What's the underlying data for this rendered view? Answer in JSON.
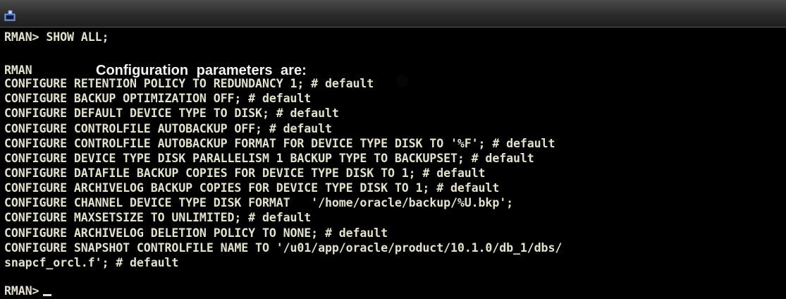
{
  "terminal": {
    "command_prompt": "RMAN> SHOW ALL;",
    "config_prefix": "RMAN",
    "config_heading": "Configuration parameters are:",
    "config_lines": [
      "CONFIGURE RETENTION POLICY TO REDUNDANCY 1; # default",
      "CONFIGURE BACKUP OPTIMIZATION OFF; # default",
      "CONFIGURE DEFAULT DEVICE TYPE TO DISK; # default",
      "CONFIGURE CONTROLFILE AUTOBACKUP OFF; # default",
      "CONFIGURE CONTROLFILE AUTOBACKUP FORMAT FOR DEVICE TYPE DISK TO '%F'; # default",
      "CONFIGURE DEVICE TYPE DISK PARALLELISM 1 BACKUP TYPE TO BACKUPSET; # default",
      "CONFIGURE DATAFILE BACKUP COPIES FOR DEVICE TYPE DISK TO 1; # default",
      "CONFIGURE ARCHIVELOG BACKUP COPIES FOR DEVICE TYPE DISK TO 1; # default",
      "CONFIGURE CHANNEL DEVICE TYPE DISK FORMAT   '/home/oracle/backup/%U.bkp';",
      "CONFIGURE MAXSETSIZE TO UNLIMITED; # default",
      "CONFIGURE ARCHIVELOG DELETION POLICY TO NONE; # default",
      "CONFIGURE SNAPSHOT CONTROLFILE NAME TO '/u01/app/oracle/product/10.1.0/db_1/dbs/",
      "snapcf_orcl.f'; # default"
    ],
    "final_prompt": "RMAN>"
  }
}
